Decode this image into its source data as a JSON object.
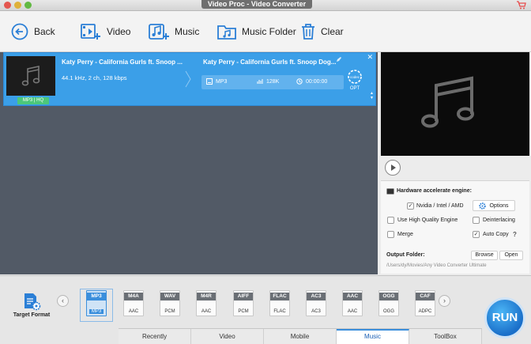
{
  "window": {
    "title": "Video Proc - Video Converter"
  },
  "toolbar": {
    "back": "Back",
    "video": "Video",
    "music": "Music",
    "music_folder": "Music Folder",
    "clear": "Clear"
  },
  "item": {
    "source_title": "Katy Perry - California Gurls ft. Snoop ...",
    "source_info": "44.1 kHz, 2 ch, 128 kbps",
    "source_badge": "MP3 | HQ",
    "output_title": "Katy Perry - California Gurls ft. Snoop Dog...",
    "output_format": "MP3",
    "output_bitrate": "128K",
    "output_duration": "00:00:00",
    "codec_option_label": "OPT",
    "codec_badge": "codec"
  },
  "settings": {
    "hw_title": "Hardware accelerate engine:",
    "nvidia_label": "Nvidia / Intel / AMD",
    "nvidia_checked": "✓",
    "options_label": "Options",
    "hq_engine": "Use High Quality Engine",
    "deinterlacing": "Deinterlacing",
    "merge": "Merge",
    "auto_copy": "Auto Copy",
    "auto_copy_checked": "✓",
    "help_mark": "?",
    "output_folder_label": "Output Folder:",
    "browse": "Browse",
    "open": "Open",
    "output_path": "/Users/dy/Movies/Any Video Converter Ultimate"
  },
  "formats": {
    "target_label": "Target Format",
    "items": [
      {
        "top": "MP3",
        "sub": "MP3"
      },
      {
        "top": "M4A",
        "sub": "AAC"
      },
      {
        "top": "WAV",
        "sub": "PCM"
      },
      {
        "top": "M4R",
        "sub": "AAC"
      },
      {
        "top": "AIFF",
        "sub": "PCM"
      },
      {
        "top": "FLAC",
        "sub": "FLAC"
      },
      {
        "top": "AC3",
        "sub": "AC3"
      },
      {
        "top": "AAC",
        "sub": "AAC"
      },
      {
        "top": "OGG",
        "sub": "OGG"
      },
      {
        "top": "CAF",
        "sub": "ADPC"
      }
    ],
    "selected_index": 0
  },
  "tabs": [
    "Recently",
    "Video",
    "Mobile",
    "Music",
    "ToolBox"
  ],
  "active_tab": "Music",
  "run_label": "RUN",
  "colors": {
    "accent": "#3b9fe8",
    "list_bg": "#525a66",
    "badge_green": "#4cc77a"
  }
}
